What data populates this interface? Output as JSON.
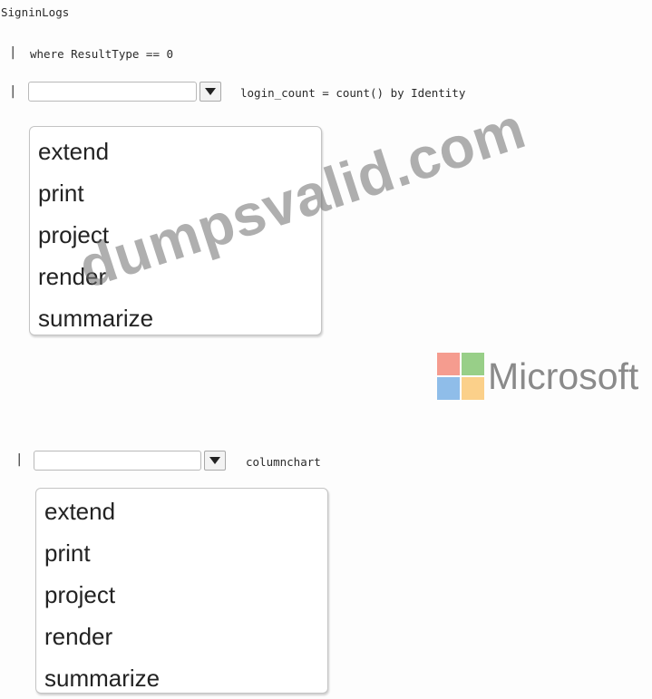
{
  "query": {
    "table": "SigninLogs",
    "line1": "where ResultType == 0",
    "pipe": "|",
    "line2_suffix": "login_count = count() by Identity",
    "line3_suffix": "columnchart"
  },
  "dropdown1": {
    "selected": "",
    "options": [
      "extend",
      "print",
      "project",
      "render",
      "summarize"
    ]
  },
  "dropdown2": {
    "selected": "",
    "options": [
      "extend",
      "print",
      "project",
      "render",
      "summarize"
    ]
  },
  "watermark": {
    "text": "dumpsvalid.com"
  },
  "brand": {
    "name": "Microsoft",
    "colors": {
      "red": "#f59c8f",
      "green": "#98cf88",
      "blue": "#8fbde9",
      "yellow": "#fbd08a"
    }
  }
}
